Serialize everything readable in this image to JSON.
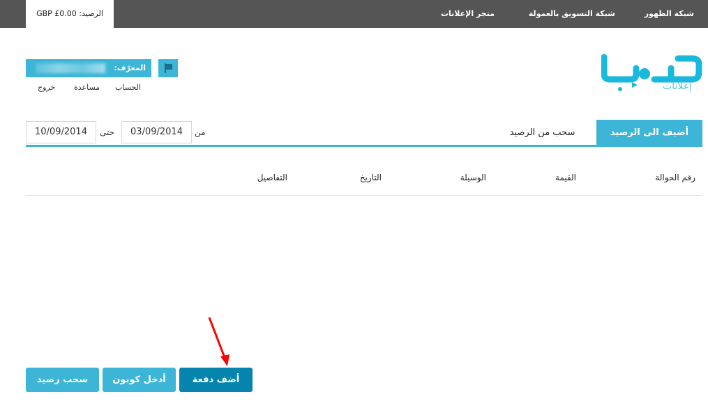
{
  "topbar": {
    "balance_label": "الرصيد: GBP £0.00",
    "nav": [
      "شبكة الظهور",
      "شبكة التسويق بالعمولة",
      "متجر الإعلانات"
    ]
  },
  "logo": {
    "text": "حساب",
    "subtitle": "إعلانات"
  },
  "user": {
    "id_label": "المعرّف:",
    "links": [
      "الحساب",
      "مساعدة",
      "خروج"
    ]
  },
  "tabs": {
    "active": "أضيف الى الرصيد",
    "other": "سحب من الرصيد"
  },
  "filter": {
    "from_label": "من",
    "from_value": "03/09/2014",
    "to_label": "حتى",
    "to_value": "10/09/2014"
  },
  "table": {
    "headers": [
      "رقم الحوالة",
      "القيمة",
      "الوسيلة",
      "التاريخ",
      "التفاصيل"
    ]
  },
  "buttons": {
    "add_payment": "أضف دفعة",
    "enter_coupon": "أدخل كوبون",
    "withdraw": "سحب رصيد"
  },
  "colors": {
    "accent": "#3db5d6",
    "primary": "#0585ae",
    "topbar": "#555555",
    "annotation": "#ff0000"
  }
}
